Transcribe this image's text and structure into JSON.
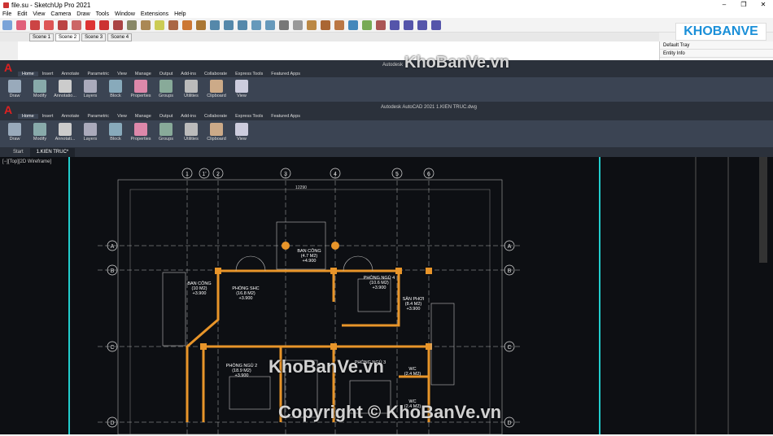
{
  "sketchup": {
    "title": "file.su - SketchUp Pro 2021",
    "window_controls": [
      "–",
      "❐",
      "✕"
    ],
    "menu": [
      "File",
      "Edit",
      "View",
      "Camera",
      "Draw",
      "Tools",
      "Window",
      "Extensions",
      "Help"
    ],
    "scenes": [
      "Scene 1",
      "Scene 2",
      "Scene 3",
      "Scene 4"
    ],
    "active_scene": "Scene 2",
    "tray": {
      "title": "Default Tray",
      "entity": "Entity Info"
    }
  },
  "watermark_logo": "KHOBANVE",
  "acad_back": {
    "title": "Autodesk",
    "tabs": [
      "Home",
      "Insert",
      "Annotate",
      "Parametric",
      "View",
      "Manage",
      "Output",
      "Add-ins",
      "Collaborate",
      "Express Tools",
      "Featured Apps"
    ],
    "ribbon": [
      "Draw",
      "Modify",
      "Annotatio...",
      "Layers",
      "Block",
      "Properties",
      "Groups",
      "Utilities",
      "Clipboard",
      "View"
    ]
  },
  "acad_front": {
    "title": "Autodesk AutoCAD 2021    1.KIEN TRUC.dwg",
    "tabs": [
      "Home",
      "Insert",
      "Annotate",
      "Parametric",
      "View",
      "Manage",
      "Output",
      "Add-ins",
      "Collaborate",
      "Express Tools",
      "Featured Apps"
    ],
    "ribbon": [
      "Draw",
      "Modify",
      "Annotati...",
      "Layers",
      "Block",
      "Properties",
      "Groups",
      "Utilities",
      "Clipboard",
      "View"
    ],
    "file_tabs": [
      "Start",
      "1.KIEN TRUC*"
    ],
    "view_label": "[−][Top][2D Wireframe]"
  },
  "drawing": {
    "grid_top": [
      "1",
      "1'",
      "2",
      "3",
      "4",
      "5",
      "6"
    ],
    "grid_side": [
      "A",
      "B",
      "C",
      "D"
    ],
    "rooms": [
      {
        "name": "BAN CÔNG",
        "area": "(4.7 M2)",
        "level": "+4.900"
      },
      {
        "name": "PHÒNG NGỦ 4",
        "area": "(10.6 M2)",
        "level": "+3.900"
      },
      {
        "name": "BAN CÔNG",
        "area": "(10 M2)",
        "level": "+3.900"
      },
      {
        "name": "PHÒNG SHC",
        "area": "(16.8 M2)",
        "level": "+3.900"
      },
      {
        "name": "SÂN PHƠI",
        "area": "(8.4 M2)",
        "level": "+3.900"
      },
      {
        "name": "PHÒNG NGỦ 2",
        "area": "(18.9 M2)",
        "level": "+3.900"
      },
      {
        "name": "PHÒNG NGỦ 3",
        "area": "",
        "level": ""
      },
      {
        "name": "WC",
        "area": "(2.4 M2)",
        "level": ""
      },
      {
        "name": "WC",
        "area": "(2.4 M2)",
        "level": ""
      }
    ],
    "total_dim": "12290"
  },
  "watermarks": [
    "KhoBanVe.vn",
    "KhoBanVe.vn",
    "Copyright © KhoBanVe.vn"
  ]
}
